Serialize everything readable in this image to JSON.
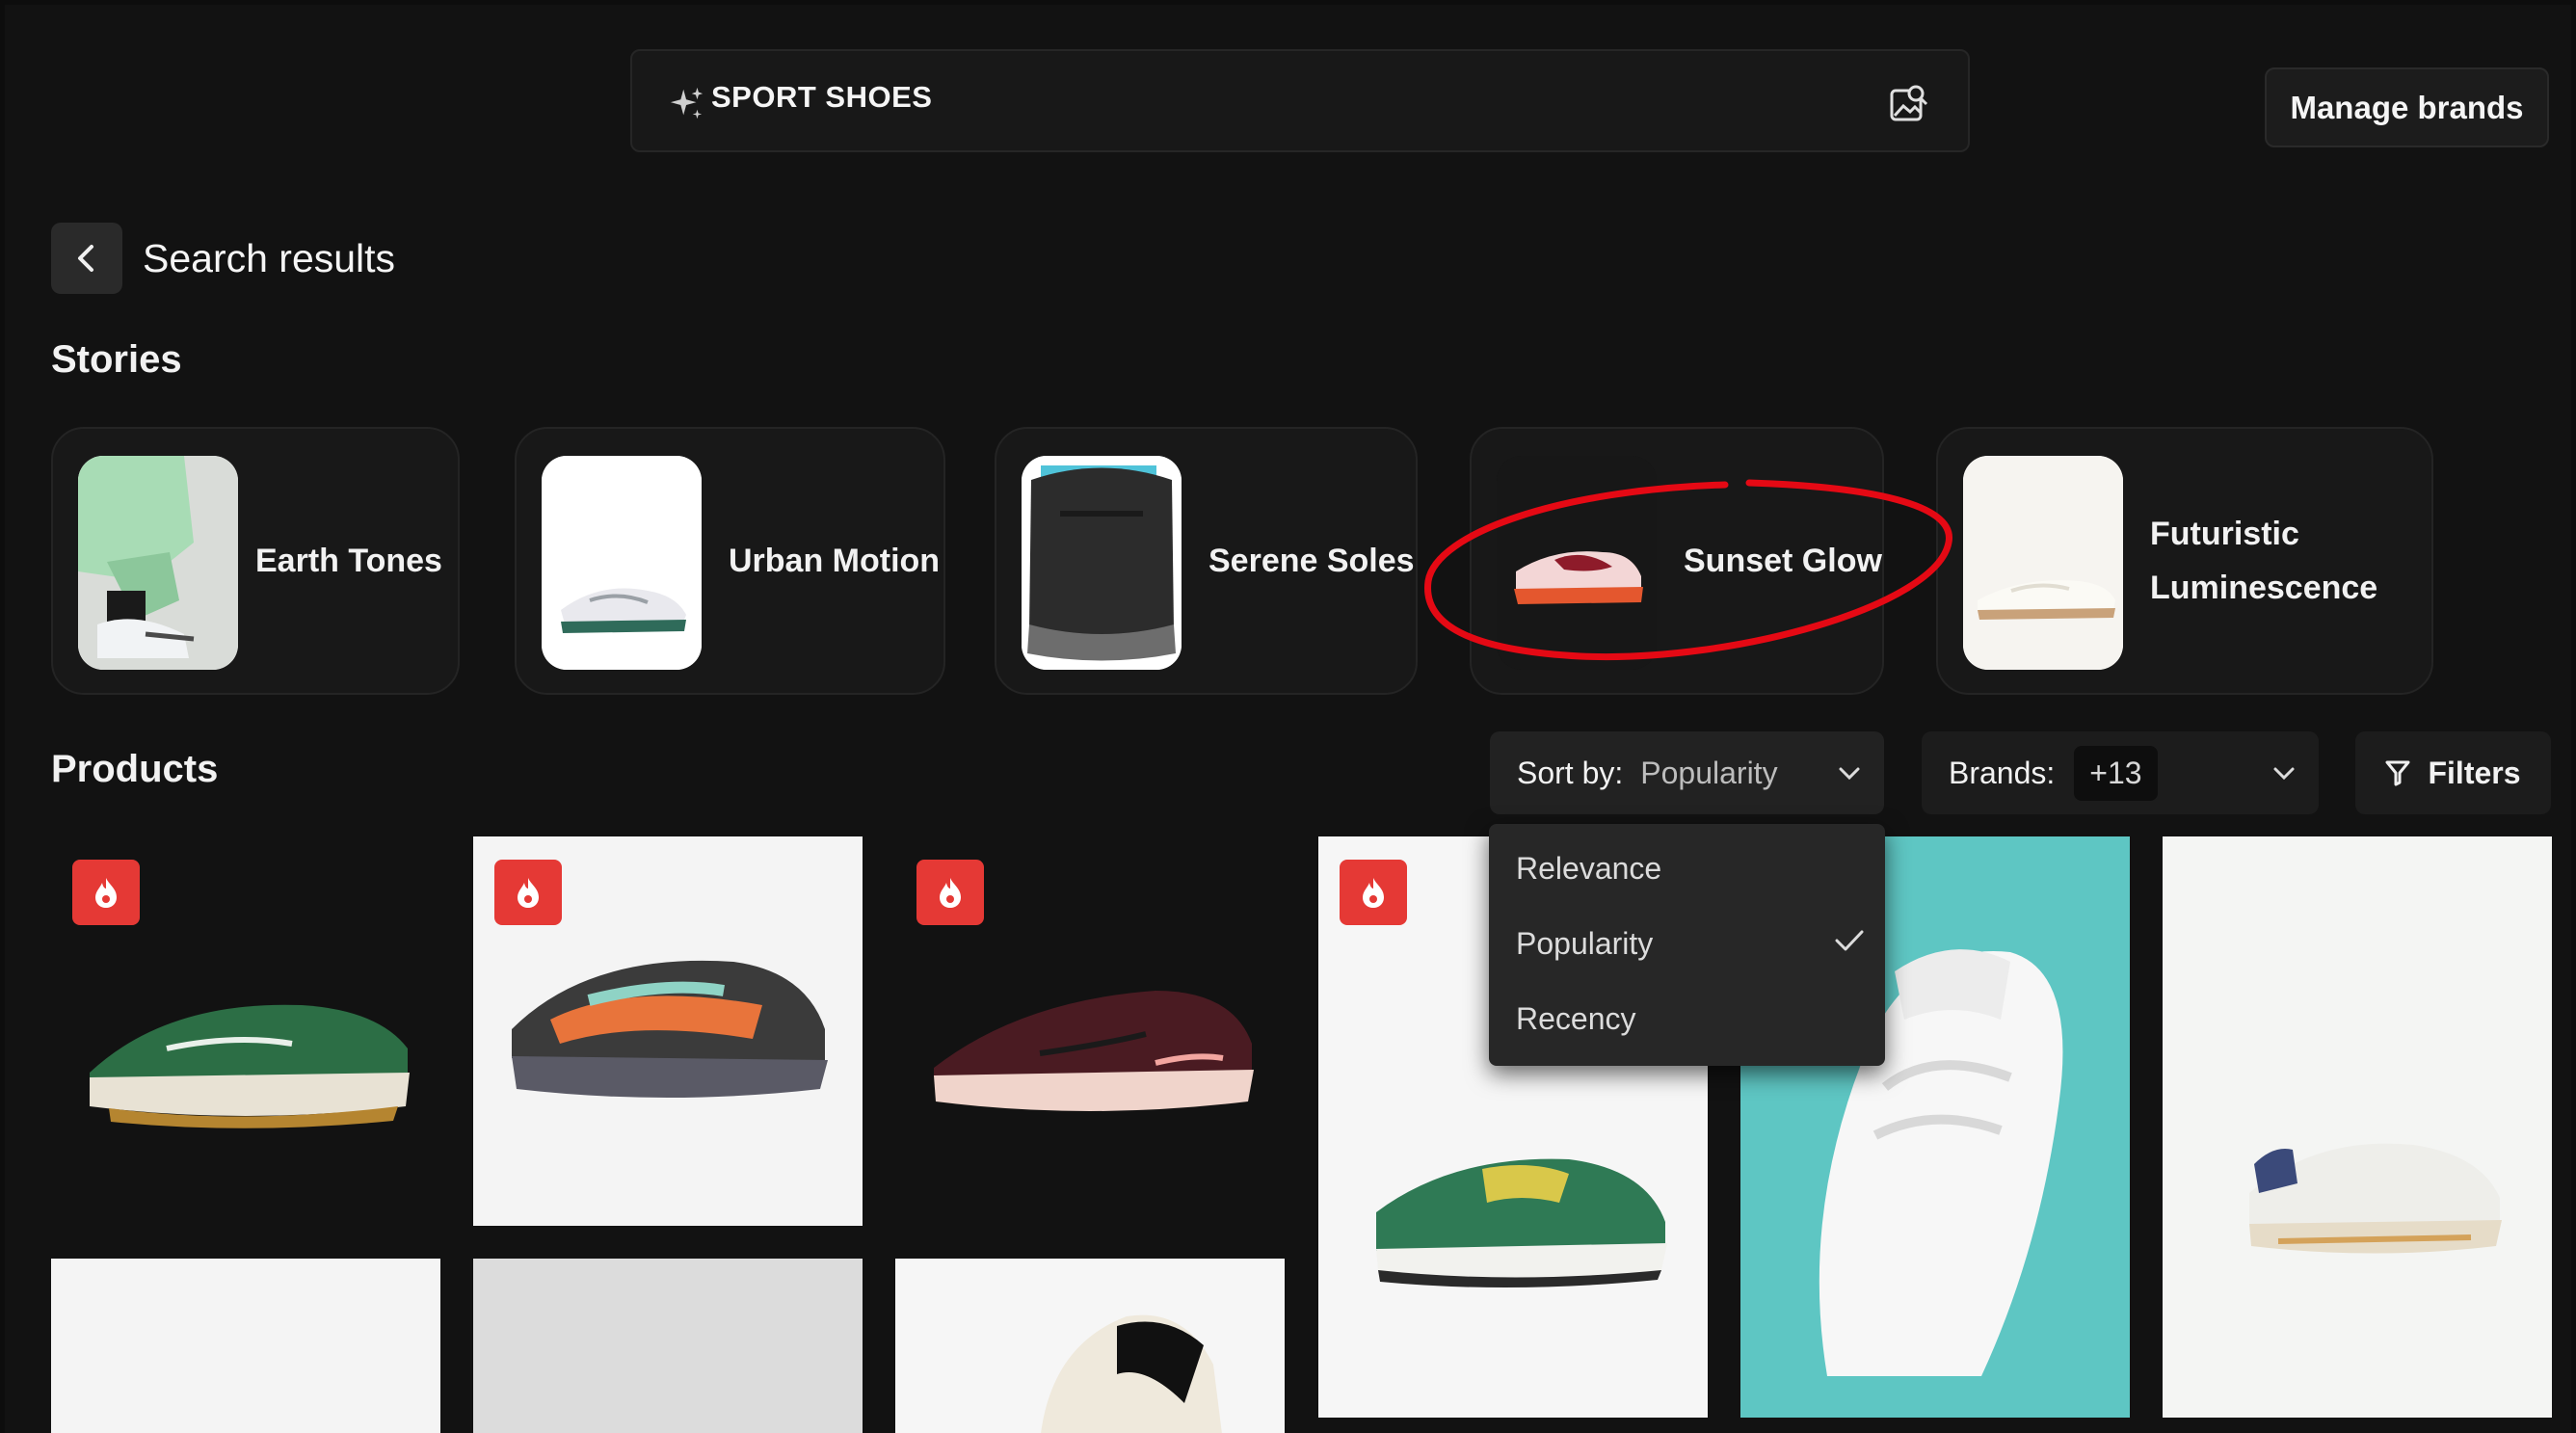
{
  "search": {
    "query": "SPORT SHOES"
  },
  "header": {
    "manage_brands": "Manage brands",
    "page_title": "Search results"
  },
  "sections": {
    "stories": "Stories",
    "products": "Products"
  },
  "stories": [
    {
      "label": "Earth Tones"
    },
    {
      "label": "Urban Motion"
    },
    {
      "label": "Serene Soles"
    },
    {
      "label": "Sunset Glow"
    },
    {
      "label_line1": "Futuristic",
      "label_line2": "Luminescence"
    }
  ],
  "sort": {
    "label": "Sort by:",
    "value": "Popularity",
    "options": [
      "Relevance",
      "Popularity",
      "Recency"
    ],
    "selected": "Popularity"
  },
  "brands": {
    "label": "Brands:",
    "count": "+13"
  },
  "filters": {
    "label": "Filters"
  },
  "colors": {
    "accent_red": "#e53935",
    "annotation_red": "#e50914",
    "background": "#121212"
  }
}
